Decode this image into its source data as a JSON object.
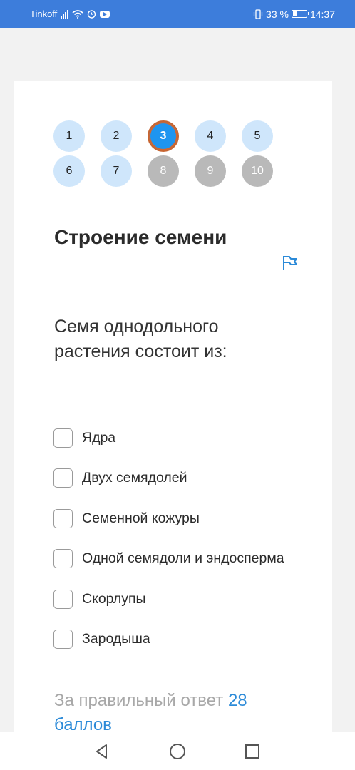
{
  "status_bar": {
    "carrier": "Tinkoff",
    "battery": "33 %",
    "battery_level": 0.33,
    "time": "14:37"
  },
  "pager": {
    "items": [
      {
        "label": "1",
        "state": "done"
      },
      {
        "label": "2",
        "state": "done"
      },
      {
        "label": "3",
        "state": "current"
      },
      {
        "label": "4",
        "state": "done"
      },
      {
        "label": "5",
        "state": "done"
      },
      {
        "label": "6",
        "state": "done"
      },
      {
        "label": "7",
        "state": "done"
      },
      {
        "label": "8",
        "state": "locked"
      },
      {
        "label": "9",
        "state": "locked"
      },
      {
        "label": "10",
        "state": "locked"
      }
    ]
  },
  "test": {
    "title": "Строение семени",
    "question": "Семя однодольного растения состоит из:",
    "options": [
      {
        "label": "Ядра",
        "checked": false
      },
      {
        "label": "Двух семядолей",
        "checked": false
      },
      {
        "label": "Семенной кожуры",
        "checked": false
      },
      {
        "label": "Одной семядоли и эндосперма",
        "checked": false
      },
      {
        "label": "Скорлупы",
        "checked": false
      },
      {
        "label": "Зародыша",
        "checked": false
      }
    ],
    "score_prefix": "За правильный ответ",
    "score_points": "28",
    "score_suffix": "баллов"
  },
  "colors": {
    "status_bar": "#3d7ddb",
    "accent": "#1e95f0",
    "done_dot": "#cfe6fb",
    "locked_dot": "#b9b9b9",
    "current_ring": "#c76531",
    "points": "#2b8ad8"
  }
}
